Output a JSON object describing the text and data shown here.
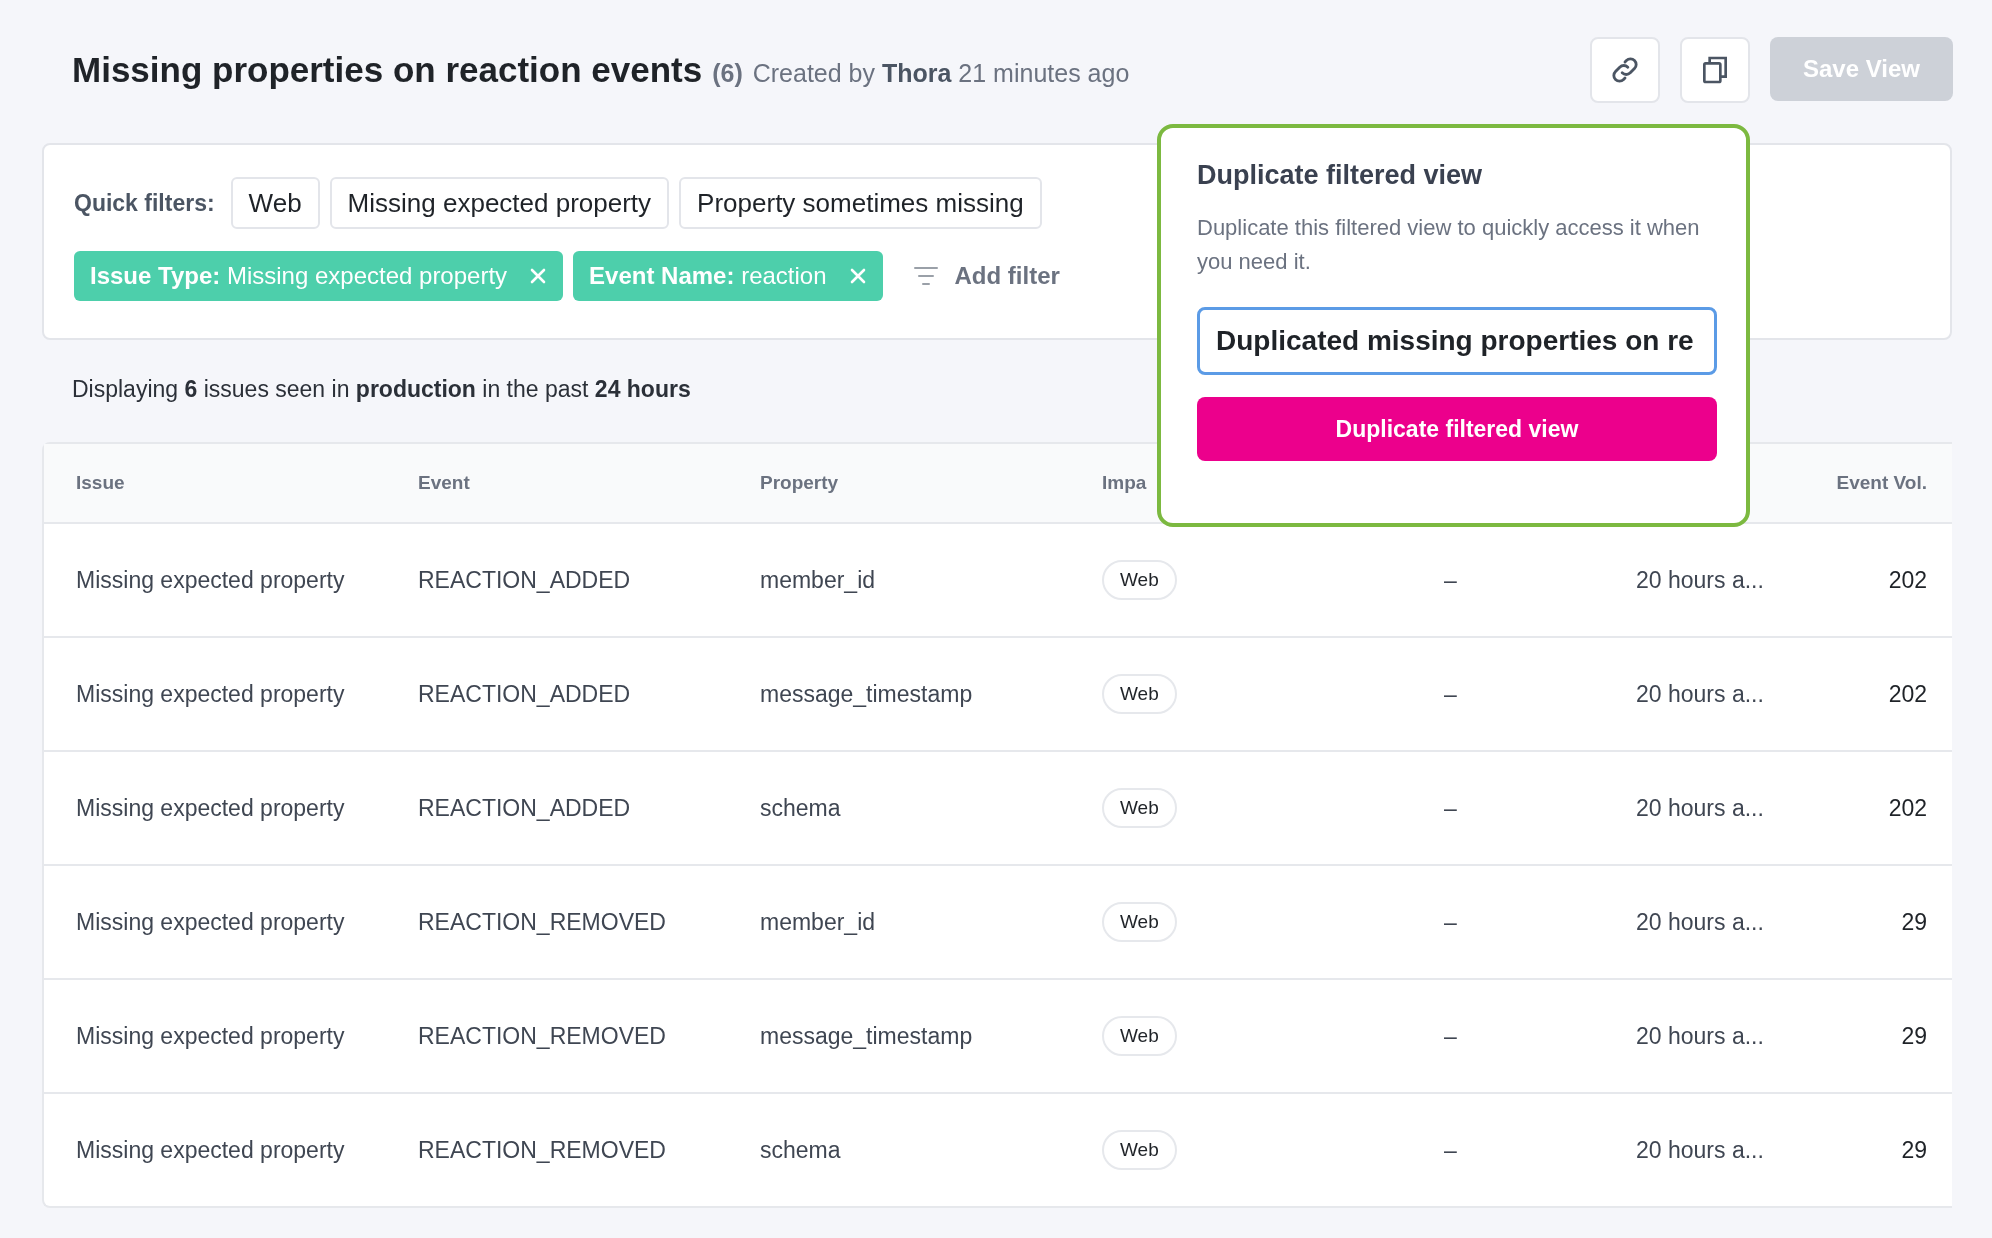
{
  "header": {
    "title": "Missing properties on reaction events",
    "count": "(6)",
    "meta": "Created by **Thora** 21 minutes ago",
    "save_button": {
      "label": "Save View",
      "disabled": true
    }
  },
  "quick_filters": {
    "label": "Quick filters:",
    "chips": [
      "Web",
      "Missing expected property",
      "Property sometimes missing"
    ]
  },
  "active_filters": [
    {
      "key": "Issue Type:",
      "value": "Missing expected property"
    },
    {
      "key": "Event Name:",
      "value": "reaction"
    }
  ],
  "add_filter": "Add filter",
  "summary": "Displaying **6** issues seen in **production** in the past **24 hours**",
  "table": {
    "columns": [
      "Issue",
      "Event",
      "Property",
      "Impa",
      "Event Vol."
    ],
    "rows": [
      {
        "issue": "Missing expected property",
        "event": "REACTION_ADDED",
        "property": "member_id",
        "platform": "Web",
        "column_5": "–",
        "column_6": "20 hours a...",
        "event_vol": "202"
      },
      {
        "issue": "Missing expected property",
        "event": "REACTION_ADDED",
        "property": "message_timestamp",
        "platform": "Web",
        "column_5": "–",
        "column_6": "20 hours a...",
        "event_vol": "202"
      },
      {
        "issue": "Missing expected property",
        "event": "REACTION_ADDED",
        "property": "schema",
        "platform": "Web",
        "column_5": "–",
        "column_6": "20 hours a...",
        "event_vol": "202"
      },
      {
        "issue": "Missing expected property",
        "event": "REACTION_REMOVED",
        "property": "member_id",
        "platform": "Web",
        "column_5": "–",
        "column_6": "20 hours a...",
        "event_vol": "29"
      },
      {
        "issue": "Missing expected property",
        "event": "REACTION_REMOVED",
        "property": "message_timestamp",
        "platform": "Web",
        "column_5": "–",
        "column_6": "20 hours a...",
        "event_vol": "29"
      },
      {
        "issue": "Missing expected property",
        "event": "REACTION_REMOVED",
        "property": "schema",
        "platform": "Web",
        "column_5": "–",
        "column_6": "20 hours a...",
        "event_vol": "29"
      }
    ]
  },
  "popover": {
    "title": "Duplicate filtered view",
    "description": "Duplicate this filtered view to quickly access it when you need it.",
    "input_value": "Duplicated missing properties on re",
    "button": "Duplicate filtered view"
  }
}
